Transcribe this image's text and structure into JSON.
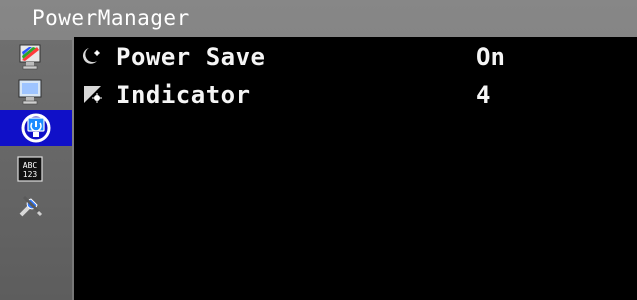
{
  "window": {
    "title": "PowerManager"
  },
  "sidebar": {
    "items": [
      {
        "icon": "color-monitor-icon",
        "selected": false
      },
      {
        "icon": "screen-monitor-icon",
        "selected": false
      },
      {
        "icon": "power-manager-icon",
        "selected": true
      },
      {
        "icon": "language-abc-123-icon",
        "selected": false
      },
      {
        "icon": "tools-icon",
        "selected": false
      }
    ]
  },
  "menu": {
    "rows": [
      {
        "icon": "power-save-icon",
        "label": "Power Save",
        "value": "On"
      },
      {
        "icon": "indicator-icon",
        "label": "Indicator",
        "value": "4"
      }
    ]
  },
  "colors": {
    "background": "#7e7e7e",
    "panel": "#000000",
    "selected": "#1010c8",
    "text": "#f5f5f5"
  }
}
